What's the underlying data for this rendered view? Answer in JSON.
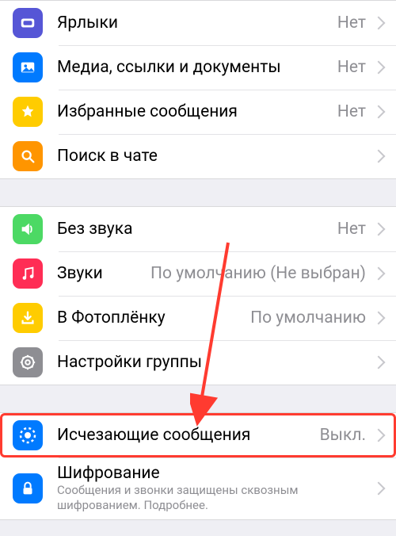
{
  "section1": {
    "labels": {
      "label": "Ярлыки",
      "value": "Нет"
    },
    "media": {
      "label": "Медиа, ссылки и документы",
      "value": "Нет"
    },
    "starred": {
      "label": "Избранные сообщения",
      "value": "Нет"
    },
    "search": {
      "label": "Поиск в чате"
    }
  },
  "section2": {
    "mute": {
      "label": "Без звука",
      "value": "Нет"
    },
    "sounds": {
      "label": "Звуки",
      "value": "По умолчанию (Не выбран)"
    },
    "saveToRoll": {
      "label": "В Фотоплёнку",
      "value": "По умолчанию"
    },
    "groupSettings": {
      "label": "Настройки группы"
    }
  },
  "section3": {
    "disappearing": {
      "label": "Исчезающие сообщения",
      "value": "Выкл."
    },
    "encryption": {
      "label": "Шифрование",
      "sub": "Сообщения и звонки защищены сквозным шифрованием.  Подробнее."
    }
  },
  "colors": {
    "blue": "#007aff",
    "yellow": "#ffcc00",
    "orange": "#ff9500",
    "green": "#4cd964",
    "pink": "#ff2d55",
    "gray": "#8e8e93"
  }
}
